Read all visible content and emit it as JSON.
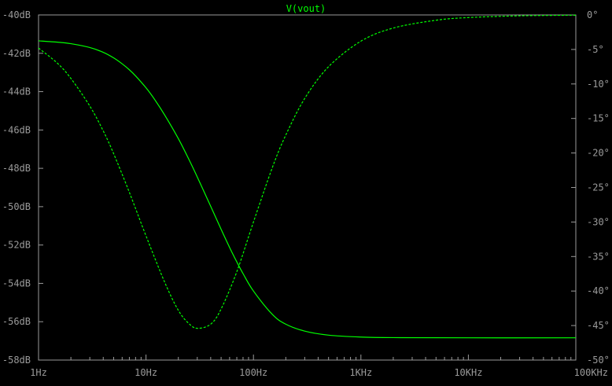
{
  "chart_data": {
    "type": "line",
    "title": "V(vout)",
    "x_scale": "log",
    "xlim_hz": [
      1,
      100000
    ],
    "x_ticks": [
      {
        "value": 1,
        "label": "1Hz"
      },
      {
        "value": 10,
        "label": "10Hz"
      },
      {
        "value": 100,
        "label": "100Hz"
      },
      {
        "value": 1000,
        "label": "1KHz"
      },
      {
        "value": 10000,
        "label": "10KHz"
      },
      {
        "value": 100000,
        "label": "100KHz"
      }
    ],
    "left_axis": {
      "unit": "dB",
      "ylim": [
        -58,
        -40
      ],
      "ticks": [
        {
          "value": -40,
          "label": "-40dB"
        },
        {
          "value": -42,
          "label": "-42dB"
        },
        {
          "value": -44,
          "label": "-44dB"
        },
        {
          "value": -46,
          "label": "-46dB"
        },
        {
          "value": -48,
          "label": "-48dB"
        },
        {
          "value": -50,
          "label": "-50dB"
        },
        {
          "value": -52,
          "label": "-52dB"
        },
        {
          "value": -54,
          "label": "-54dB"
        },
        {
          "value": -56,
          "label": "-56dB"
        },
        {
          "value": -58,
          "label": "-58dB"
        }
      ]
    },
    "right_axis": {
      "unit": "degrees",
      "ylim": [
        -50,
        0
      ],
      "ticks": [
        {
          "value": 0,
          "label": "0°"
        },
        {
          "value": -5,
          "label": "-5°"
        },
        {
          "value": -10,
          "label": "-10°"
        },
        {
          "value": -15,
          "label": "-15°"
        },
        {
          "value": -20,
          "label": "-20°"
        },
        {
          "value": -25,
          "label": "-25°"
        },
        {
          "value": -30,
          "label": "-30°"
        },
        {
          "value": -35,
          "label": "-35°"
        },
        {
          "value": -40,
          "label": "-40°"
        },
        {
          "value": -45,
          "label": "-45°"
        },
        {
          "value": -50,
          "label": "-50°"
        }
      ]
    },
    "series": [
      {
        "quantity": "magnitude",
        "axis": "left",
        "style": "solid",
        "x": [
          1,
          1.5,
          2,
          3,
          4,
          5,
          6,
          7,
          8,
          10,
          12,
          15,
          20,
          25,
          30,
          40,
          50,
          60,
          70,
          80,
          100,
          150,
          200,
          300,
          500,
          1000,
          2000,
          10000,
          100000
        ],
        "values": [
          -41.35,
          -41.42,
          -41.5,
          -41.7,
          -41.95,
          -42.24,
          -42.55,
          -42.86,
          -43.18,
          -43.8,
          -44.4,
          -45.24,
          -46.45,
          -47.52,
          -48.45,
          -49.98,
          -51.18,
          -52.13,
          -52.88,
          -53.49,
          -54.4,
          -55.62,
          -56.13,
          -56.49,
          -56.7,
          -56.8,
          -56.83,
          -56.84,
          -56.84
        ]
      },
      {
        "quantity": "phase",
        "axis": "right",
        "style": "dashed",
        "x": [
          1,
          1.5,
          2,
          3,
          4,
          5,
          7,
          10,
          15,
          20,
          25,
          30,
          40,
          50,
          70,
          100,
          150,
          200,
          300,
          500,
          1000,
          2000,
          5000,
          10000,
          30000,
          100000
        ],
        "values": [
          -4.8,
          -7.0,
          -9.2,
          -13.2,
          -16.8,
          -20.1,
          -25.7,
          -32.0,
          -38.8,
          -42.8,
          -44.7,
          -45.4,
          -44.8,
          -42.6,
          -37.2,
          -30.0,
          -22.1,
          -17.4,
          -12.1,
          -7.5,
          -3.8,
          -1.9,
          -0.77,
          -0.38,
          -0.13,
          -0.04
        ]
      }
    ],
    "trace_color": "#00ff00",
    "axis_color": "#9a9a9a",
    "background": "#000000",
    "grid": false
  }
}
